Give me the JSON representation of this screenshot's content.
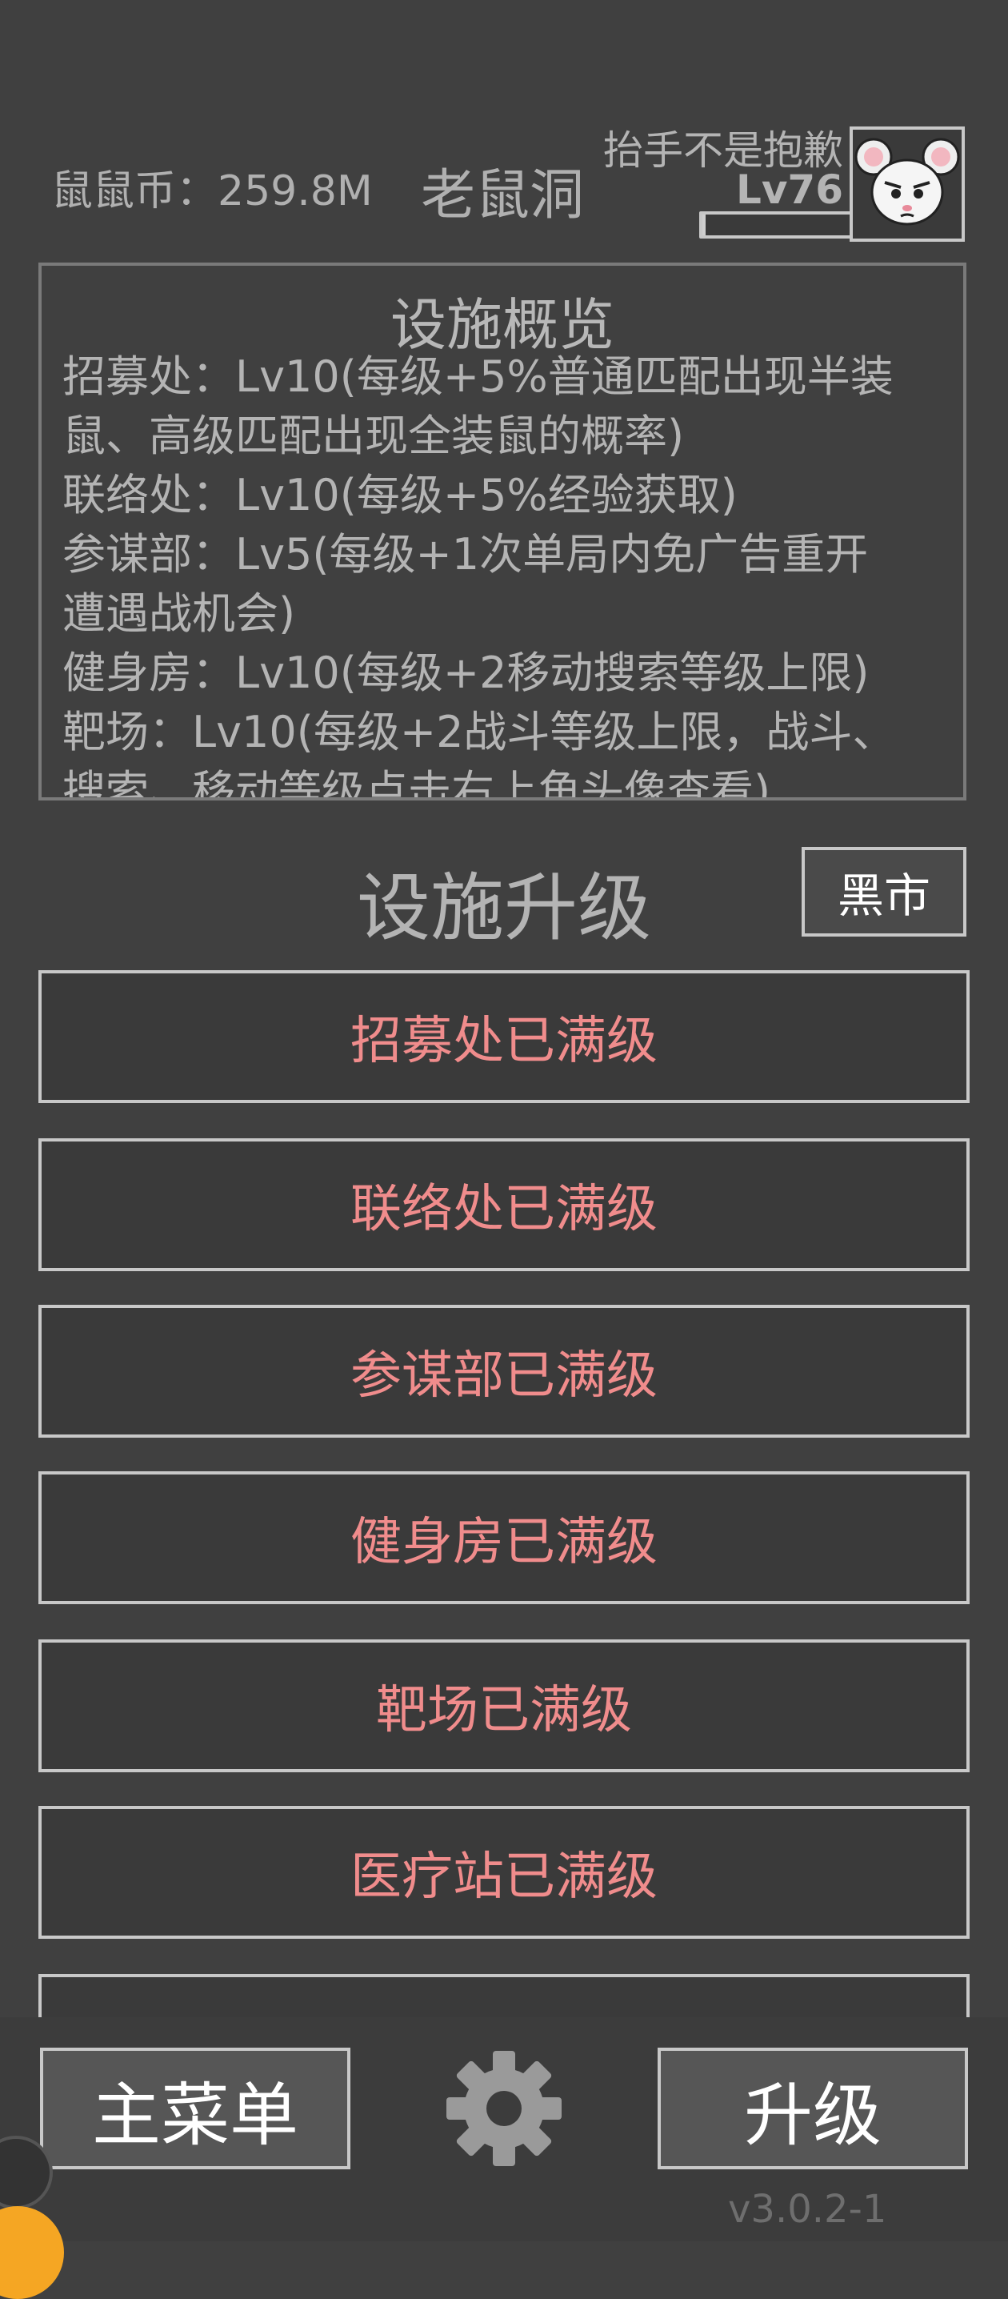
{
  "header": {
    "coins_label": "鼠鼠币：259.8M",
    "page_title": "老鼠洞",
    "player_name": "抬手不是抱歉",
    "player_level": "Lv76",
    "xp_progress": 0.02
  },
  "overview": {
    "title": "设施概览",
    "lines": [
      "招募处：Lv10(每级+5%普通匹配出现半装",
      "鼠、高级匹配出现全装鼠的概率)",
      "联络处：Lv10(每级+5%经验获取)",
      "参谋部：Lv5(每级+1次单局内免广告重开",
      "遭遇战机会)",
      "健身房：Lv10(每级+2移动搜索等级上限)",
      "靶场：Lv10(每级+2战斗等级上限，战斗、",
      "搜索、移动等级点击右上角头像查看)"
    ]
  },
  "upgrade": {
    "title": "设施升级",
    "black_market": "黑市",
    "items": [
      "招募处已满级",
      "联络处已满级",
      "参谋部已满级",
      "健身房已满级",
      "靶场已满级",
      "医疗站已满级",
      ""
    ]
  },
  "bottom": {
    "main_menu": "主菜单",
    "upgrade": "升级",
    "version": "v3.0.2-1"
  },
  "icons": {
    "avatar": "mouse-avatar-icon",
    "settings": "gear-icon"
  },
  "colors": {
    "background": "#404040",
    "maxed_text": "#f08c8c",
    "border": "#c8c8c8"
  }
}
